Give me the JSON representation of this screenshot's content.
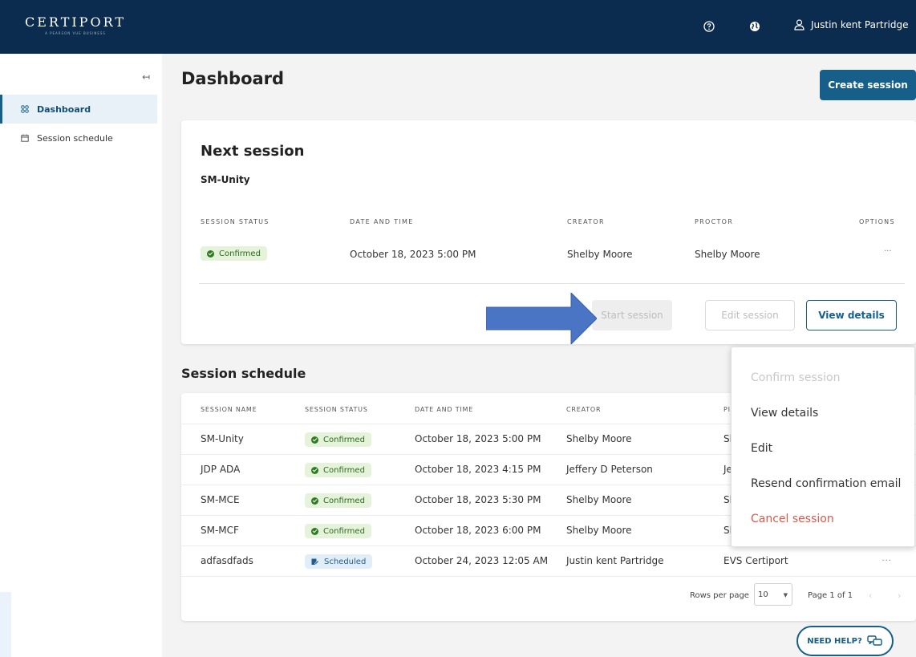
{
  "header": {
    "logo_text": "CERTIPORT",
    "logo_subtitle": "A PEARSON VUE BUSINESS",
    "user_name": "Justin kent Partridge",
    "icons": [
      "help-icon",
      "globe-icon",
      "user-icon"
    ]
  },
  "sidebar": {
    "collapse_label": "↤",
    "items": [
      {
        "label": "Dashboard",
        "icon": "dashboard-icon",
        "active": true
      },
      {
        "label": "Session schedule",
        "icon": "calendar-icon",
        "active": false
      }
    ]
  },
  "page": {
    "title": "Dashboard",
    "create_button": "Create session"
  },
  "next_session": {
    "title": "Next session",
    "name": "SM-Unity",
    "columns": [
      "SESSION STATUS",
      "DATE AND TIME",
      "CREATOR",
      "PROCTOR",
      "OPTIONS"
    ],
    "status": "Confirmed",
    "date_time": "October 18, 2023 5:00 PM",
    "creator": "Shelby Moore",
    "proctor": "Shelby Moore",
    "options": "···",
    "buttons": {
      "start": "Start session",
      "edit": "Edit session",
      "view": "View details"
    }
  },
  "schedule": {
    "title": "Session schedule",
    "columns": [
      "SESSION NAME",
      "SESSION STATUS",
      "DATE AND TIME",
      "CREATOR",
      "PI"
    ],
    "rows": [
      {
        "name": "SM-Unity",
        "status": "Confirmed",
        "date": "October 18, 2023 5:00 PM",
        "creator": "Shelby Moore",
        "proctor": "Sl"
      },
      {
        "name": "JDP ADA",
        "status": "Confirmed",
        "date": "October 18, 2023 4:15 PM",
        "creator": "Jeffery D Peterson",
        "proctor": "Je"
      },
      {
        "name": "SM-MCE",
        "status": "Confirmed",
        "date": "October 18, 2023 5:30 PM",
        "creator": "Shelby Moore",
        "proctor": "Sl"
      },
      {
        "name": "SM-MCF",
        "status": "Confirmed",
        "date": "October 18, 2023 6:00 PM",
        "creator": "Shelby Moore",
        "proctor": "Sl"
      },
      {
        "name": "adfasdfads",
        "status": "Scheduled",
        "date": "October 24, 2023 12:05 AM",
        "creator": "Justin kent Partridge",
        "proctor": "EVS Certiport"
      }
    ],
    "options_glyph": "···",
    "rows_per_page_label": "Rows per page",
    "rows_per_page_value": "10",
    "page_label": "Page 1 of 1"
  },
  "context_menu": {
    "items": [
      {
        "label": "Confirm session",
        "state": "disabled"
      },
      {
        "label": "View details",
        "state": "normal"
      },
      {
        "label": "Edit",
        "state": "normal"
      },
      {
        "label": "Resend confirmation email",
        "state": "normal"
      },
      {
        "label": "Cancel session",
        "state": "danger"
      }
    ]
  },
  "help_button": "NEED HELP?",
  "colors": {
    "header_bg": "#0c2c4f",
    "primary": "#155f8a",
    "confirmed_bg": "#e4f3d9",
    "scheduled_bg": "#e1eef8",
    "danger": "#d9594a",
    "arrow": "#4a74c4"
  }
}
